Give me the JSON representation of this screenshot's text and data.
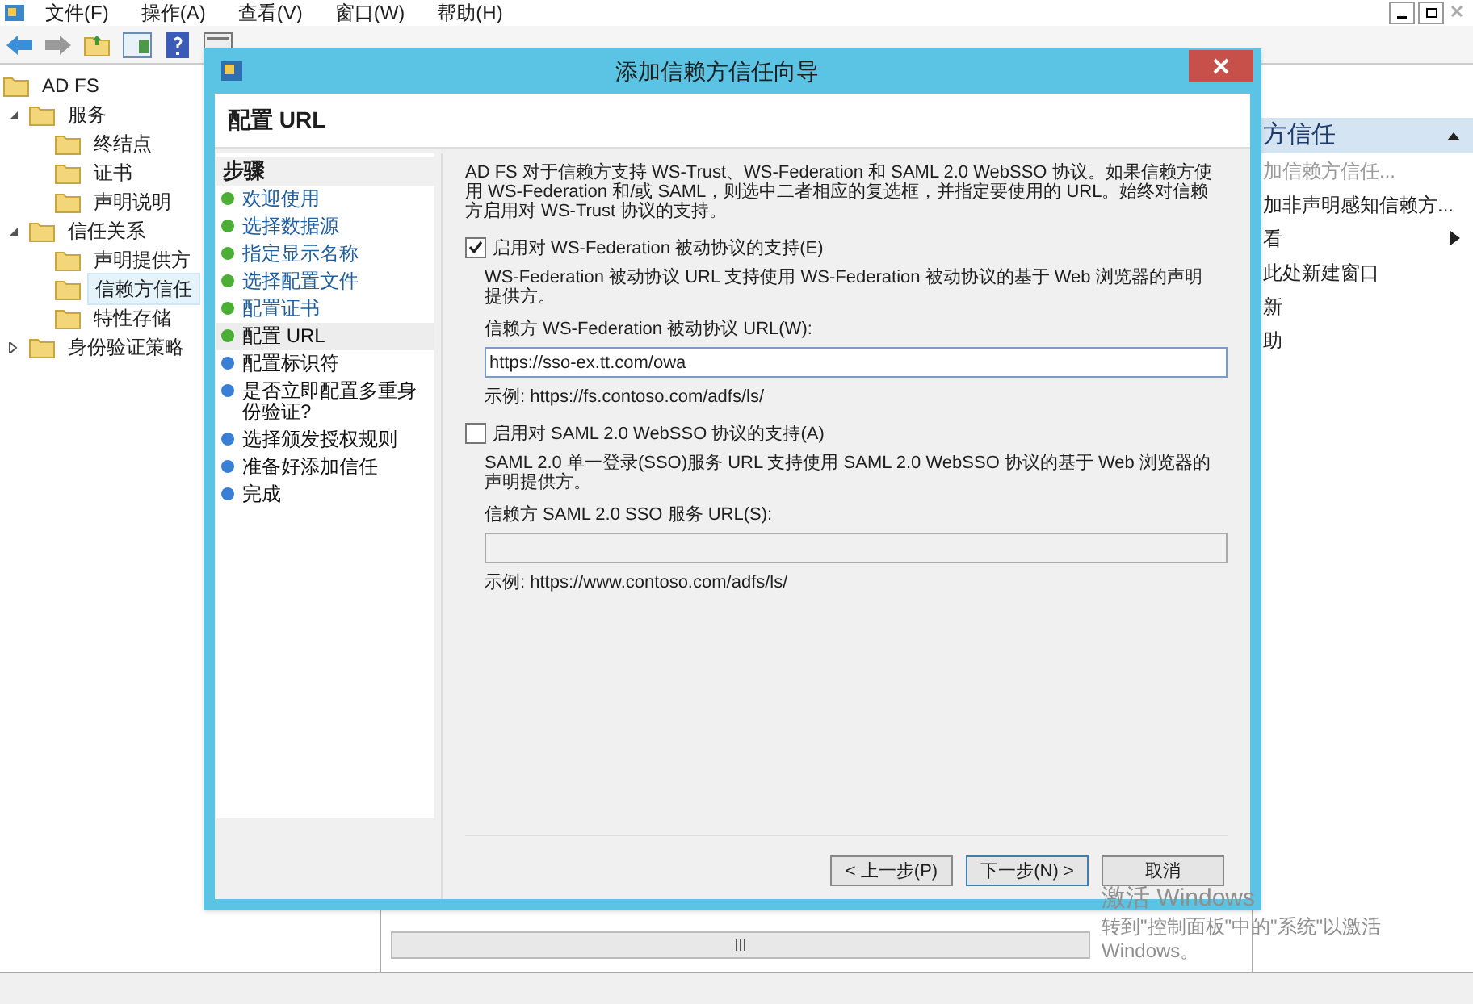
{
  "menu": [
    "文件(F)",
    "操作(A)",
    "查看(V)",
    "窗口(W)",
    "帮助(H)"
  ],
  "tree": [
    {
      "label": "AD FS",
      "selected": false,
      "children": [
        {
          "label": "服务",
          "expanded": true,
          "selected": false,
          "children": [
            {
              "label": "终结点",
              "selected": false
            },
            {
              "label": "证书",
              "selected": false
            },
            {
              "label": "声明说明",
              "selected": false
            }
          ]
        },
        {
          "label": "信任关系",
          "expanded": true,
          "selected": false,
          "children": [
            {
              "label": "声明提供方",
              "selected": false
            },
            {
              "label": "信赖方信任",
              "selected": true
            },
            {
              "label": "特性存储",
              "selected": false
            }
          ]
        },
        {
          "label": "身份验证策略",
          "expanded": false,
          "selected": false
        }
      ]
    }
  ],
  "actions": {
    "header": "方信任",
    "items": [
      {
        "label": "加信赖方信任...",
        "disabled": true,
        "submenu": false
      },
      {
        "label": "加非声明感知信赖方...",
        "disabled": false,
        "submenu": false
      },
      {
        "label": "看",
        "disabled": false,
        "submenu": true
      },
      {
        "label": "此处新建窗口",
        "disabled": false,
        "submenu": false
      },
      {
        "label": "新",
        "disabled": false,
        "submenu": false
      },
      {
        "label": "助",
        "disabled": false,
        "submenu": false
      }
    ]
  },
  "dialog": {
    "title": "添加信赖方信任向导",
    "heading": "配置 URL",
    "steps_title": "步骤",
    "steps": [
      {
        "label": "欢迎使用",
        "completed": true,
        "selected": false
      },
      {
        "label": "选择数据源",
        "completed": true,
        "selected": false
      },
      {
        "label": "指定显示名称",
        "completed": true,
        "selected": false
      },
      {
        "label": "选择配置文件",
        "completed": true,
        "selected": false
      },
      {
        "label": "配置证书",
        "completed": true,
        "selected": false
      },
      {
        "label": "配置 URL",
        "completed": true,
        "selected": true
      },
      {
        "label": "配置标识符",
        "completed": false,
        "selected": false
      },
      {
        "label": "是否立即配置多重身份验证?",
        "completed": false,
        "selected": false
      },
      {
        "label": "选择颁发授权规则",
        "completed": false,
        "selected": false
      },
      {
        "label": "准备好添加信任",
        "completed": false,
        "selected": false
      },
      {
        "label": "完成",
        "completed": false,
        "selected": false
      }
    ],
    "intro": "AD FS 对于信赖方支持 WS-Trust、WS-Federation 和 SAML 2.0 WebSSO 协议。如果信赖方使用 WS-Federation 和/或 SAML，则选中二者相应的复选框，并指定要使用的 URL。始终对信赖方启用对 WS-Trust 协议的支持。",
    "sections": [
      {
        "checkbox": "启用对 WS-Federation 被动协议的支持(E)",
        "checked": true,
        "description": "WS-Federation 被动协议 URL 支持使用 WS-Federation 被动协议的基于 Web 浏览器的声明提供方。",
        "field_label": "信赖方 WS-Federation 被动协议 URL(W):",
        "value": "https://sso-ex.tt.com/owa",
        "example": "示例: https://fs.contoso.com/adfs/ls/"
      },
      {
        "checkbox": "启用对 SAML 2.0 WebSSO 协议的支持(A)",
        "checked": false,
        "description": "SAML 2.0 单一登录(SSO)服务 URL 支持使用 SAML 2.0 WebSSO 协议的基于 Web 浏览器的声明提供方。",
        "field_label": "信赖方 SAML 2.0 SSO 服务 URL(S):",
        "example": "示例: https://www.contoso.com/adfs/ls/"
      }
    ],
    "buttons": [
      {
        "label": "< 上一步(P)",
        "kind": "back"
      },
      {
        "label": "下一步(N) >",
        "kind": "next"
      },
      {
        "label": "取消",
        "kind": "cancel"
      }
    ]
  },
  "activation": {
    "title": "激活 Windows",
    "line1": "转到\"控制面板\"中的\"系统\"以激活",
    "line2": "Windows。"
  }
}
